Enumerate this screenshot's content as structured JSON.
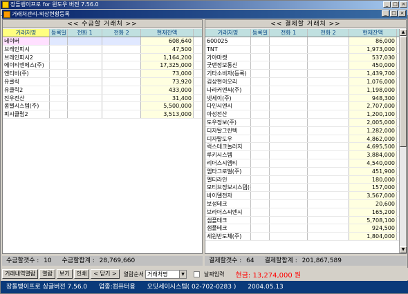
{
  "window": {
    "title": "장돌뱅이프로 for 윈도우 버전 7.56.0",
    "child_title": "거래처관리-외상현황등록"
  },
  "left": {
    "title": "<<   수금할 거래처   >>",
    "columns": [
      "거래처명",
      "등록일",
      "전화 1",
      "전화 2",
      "현재잔액"
    ],
    "rows": [
      [
        "네이버",
        "",
        "",
        "",
        "608,640"
      ],
      [
        "브레인피시",
        "",
        "",
        "",
        "47,500"
      ],
      [
        "브레인피시2",
        "",
        "",
        "",
        "1,164,200"
      ],
      [
        "에이티엔에스(주)",
        "",
        "",
        "",
        "17,325,000"
      ],
      [
        "엔티비(주)",
        "",
        "",
        "",
        "73,000"
      ],
      [
        "유클릭",
        "",
        "",
        "",
        "73,920"
      ],
      [
        "유클릭2",
        "",
        "",
        "",
        "433,000"
      ],
      [
        "진우전산",
        "",
        "",
        "",
        "31,400"
      ],
      [
        "콤텔시스템(주)",
        "",
        "",
        "",
        "5,500,000"
      ],
      [
        "피시클럽2",
        "",
        "",
        "",
        "3,513,000"
      ]
    ],
    "summary": {
      "count_label": "수금할갯수 :",
      "count": "10",
      "total_label": "수금할합계 :",
      "total": "28,769,660"
    }
  },
  "right": {
    "title": "<<   결제할 거래처   >>",
    "columns": [
      "거래처명",
      "등록일",
      "전화 1",
      "전화 2",
      "현재잔액"
    ],
    "rows": [
      [
        "600025",
        "",
        "",
        "",
        "86,000"
      ],
      [
        "TNT",
        "",
        "",
        "",
        "1,973,000"
      ],
      [
        "가야마켓",
        "",
        "",
        "",
        "537,030"
      ],
      [
        "굿맨정보통신",
        "",
        "",
        "",
        "450,000"
      ],
      [
        "기타소비자(등록)",
        "",
        "",
        "",
        "1,439,700"
      ],
      [
        "김상현이오리",
        "",
        "",
        "",
        "1,076,000"
      ],
      [
        "나라커엔씨(주)",
        "",
        "",
        "",
        "1,198,000"
      ],
      [
        "넷세이(주)",
        "",
        "",
        "",
        "948,300"
      ],
      [
        "다인시엔시",
        "",
        "",
        "",
        "2,707,000"
      ],
      [
        "아성전산",
        "",
        "",
        "",
        "1,200,100"
      ],
      [
        "도우정보(주)",
        "",
        "",
        "",
        "2,005,000"
      ],
      [
        "디자탈그린텍",
        "",
        "",
        "",
        "1,282,000"
      ],
      [
        "디자탈도우",
        "",
        "",
        "",
        "4,862,000"
      ],
      [
        "럭스테크놀러지",
        "",
        "",
        "",
        "4,695,500"
      ],
      [
        "루키시스템",
        "",
        "",
        "",
        "3,884,000"
      ],
      [
        "리더스시엠티",
        "",
        "",
        "",
        "4,540,000"
      ],
      [
        "엠타그로벌(주)",
        "",
        "",
        "",
        "451,900"
      ],
      [
        "멜티라인",
        "",
        "",
        "",
        "180,000"
      ],
      [
        "모티브정보시스템(주)",
        "",
        "",
        "",
        "157,000"
      ],
      [
        "바이델전자",
        "",
        "",
        "",
        "3,567,000"
      ],
      [
        "보성테크",
        "",
        "",
        "",
        "20,600"
      ],
      [
        "브라더스씨엔시",
        "",
        "",
        "",
        "165,200"
      ],
      [
        "샘플테크",
        "",
        "",
        "",
        "5,708,100"
      ],
      [
        "샘플테크",
        "",
        "",
        "",
        "924,500"
      ],
      [
        "세원반도체(주)",
        "",
        "",
        "",
        "1,804,000"
      ]
    ],
    "summary": {
      "count_label": "결제할갯수 :",
      "count": "64",
      "total_label": "결제할합계 :",
      "total": "201,867,589"
    }
  },
  "toolbar": {
    "btn_history": "거래내역열람",
    "btn_view": "열람",
    "btn_edit": "보기",
    "btn_print": "인쇄",
    "btn_close": "< 닫기 >",
    "sort_label": "열람순서",
    "sort_value": "거래처명",
    "date_check": "날짜입력",
    "cash_label": "현금:",
    "cash_value": "13,274,000",
    "cash_unit": "원"
  },
  "status": {
    "product": "장돌뱅이프로 싱글버전 7.56.0",
    "business": "업종:컴퓨터용",
    "company": "오딧세이시스템( 02-702-0283 )",
    "date": "2004.05.13"
  }
}
